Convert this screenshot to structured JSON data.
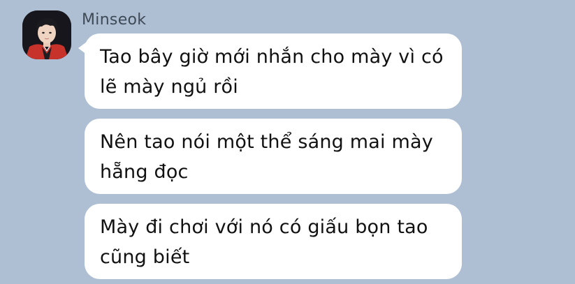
{
  "sender": {
    "name": "Minseok"
  },
  "messages": [
    {
      "text": "Tao bây giờ mới nhắn cho mày vì có lẽ mày ngủ rồi"
    },
    {
      "text": "Nên tao nói một thể sáng mai mày hẵng đọc"
    },
    {
      "text": "Mày đi chơi với nó có giấu bọn tao cũng biết"
    }
  ],
  "colors": {
    "background": "#aebfd3",
    "bubble": "#ffffff",
    "text": "#111111",
    "name": "#3f4a57"
  }
}
